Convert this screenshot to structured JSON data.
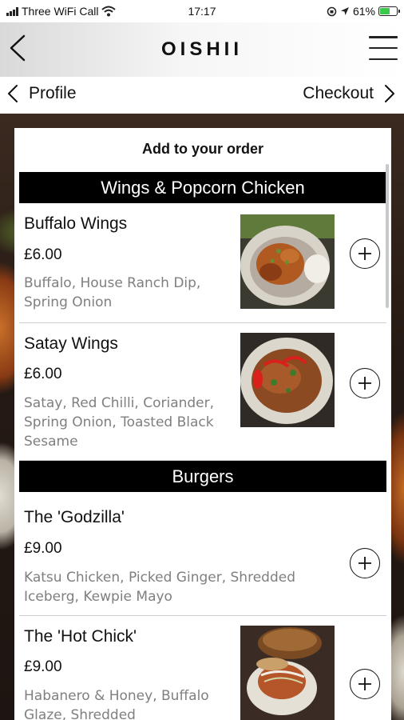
{
  "status_bar": {
    "carrier": "Three WiFi Call",
    "time": "17:17",
    "battery_percent": "61%",
    "battery_level": 0.61
  },
  "header": {
    "brand": "OISHII",
    "back_icon": "chevron-left-icon",
    "menu_icon": "hamburger-menu-icon"
  },
  "nav": {
    "prev_label": "Profile",
    "next_label": "Checkout"
  },
  "order": {
    "title": "Add to your order",
    "sections": [
      {
        "name": "Wings & Popcorn Chicken",
        "items": [
          {
            "name": "Buffalo Wings",
            "price": "£6.00",
            "description": "Buffalo, House Ranch Dip, Spring Onion"
          },
          {
            "name": "Satay Wings",
            "price": "£6.00",
            "description": "Satay, Red Chilli, Coriander, Spring Onion, Toasted Black Sesame"
          }
        ]
      },
      {
        "name": "Burgers",
        "items": [
          {
            "name": "The 'Godzilla'",
            "price": "£9.00",
            "description": "Katsu Chicken, Picked Ginger, Shredded Iceberg, Kewpie Mayo"
          },
          {
            "name": "The 'Hot Chick'",
            "price": "£9.00",
            "description": "Habanero & Honey, Buffalo Glaze, Shredded"
          }
        ]
      }
    ]
  },
  "colors": {
    "accent": "#000000",
    "battery": "#3cc84a",
    "description_text": "#7f7f7f"
  }
}
